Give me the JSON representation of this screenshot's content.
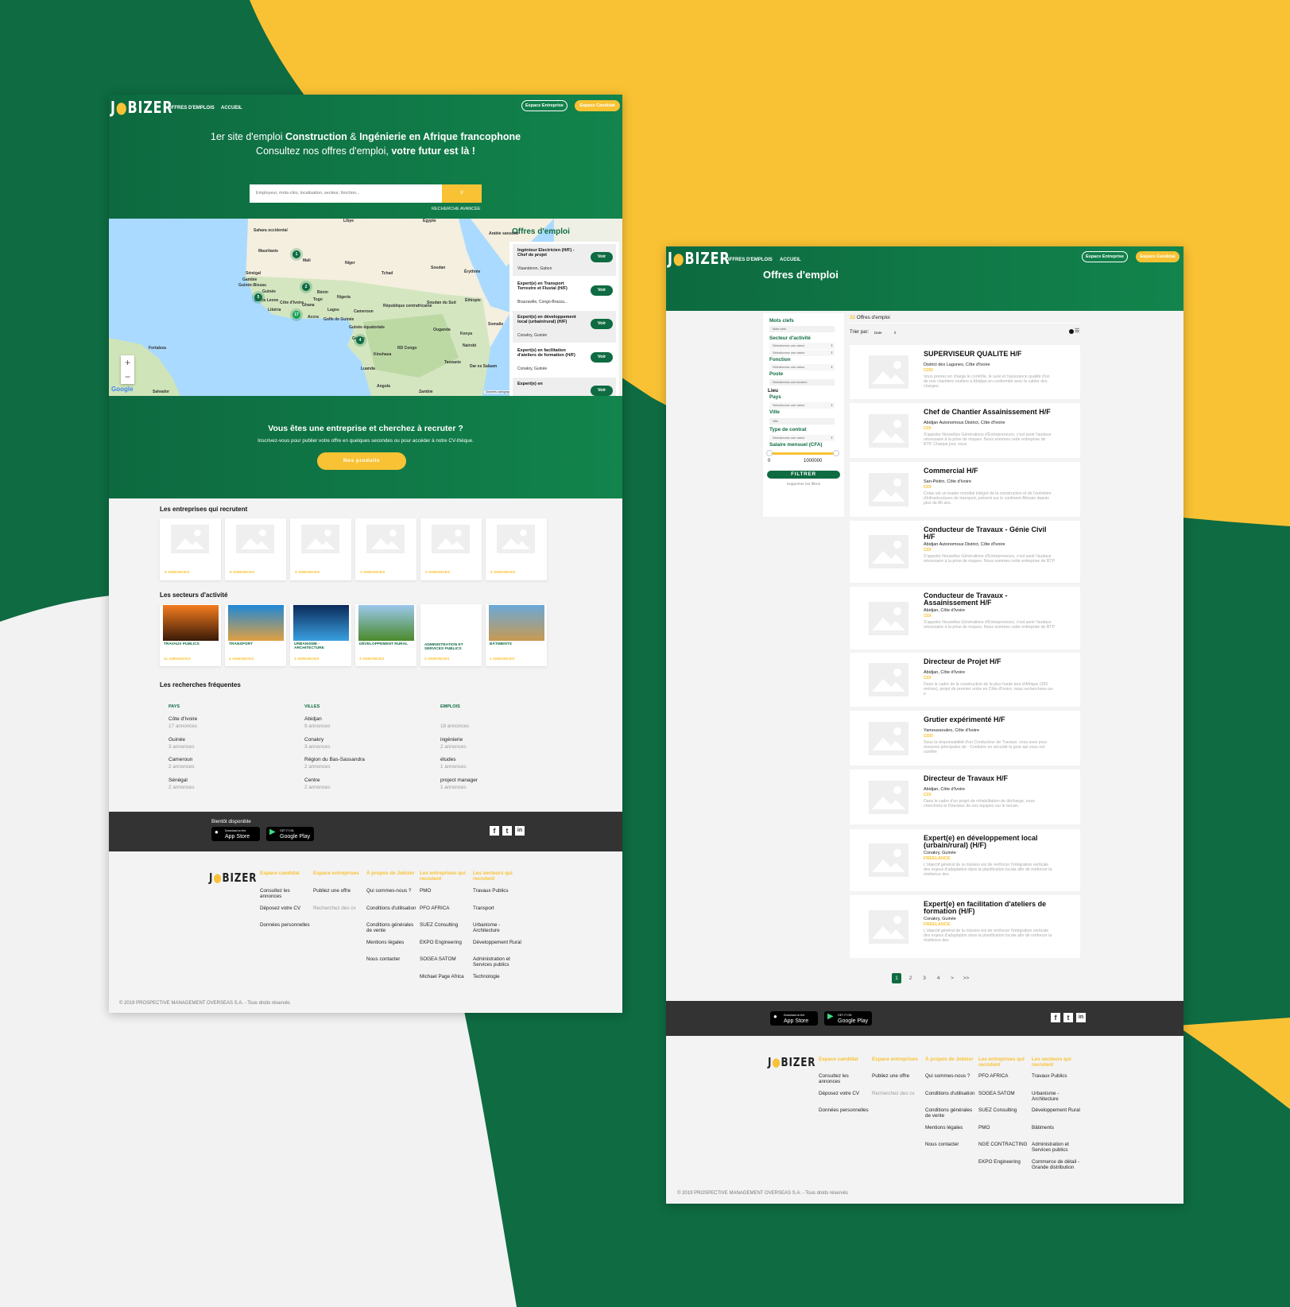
{
  "colors": {
    "green": "#0e6b42",
    "yellow": "#f9c234",
    "light": "#f3f3f3",
    "dark": "#333333"
  },
  "home": {
    "logo": "JOBIZER",
    "nav": [
      "OFFRES D'EMPLOIS",
      "ACCUEIL"
    ],
    "btn_company": "Espace Entreprise",
    "btn_candidate": "Espace Candidat",
    "headline_1a": "1er site d'emploi ",
    "headline_1b": "Construction",
    "headline_1c": " & ",
    "headline_1d": "Ingénierie en Afrique francophone",
    "headline_2a": "Consultez nos offres d'emploi, ",
    "headline_2b": "votre futur est là !",
    "search_placeholder": "Employeur, mots-clés, localisation, secteur, fonction...",
    "search_icon": "search-icon",
    "advanced": "RECHERCHE AVANCÉE",
    "map": {
      "labels": [
        "Libye",
        "Égypte",
        "Sahara occidental",
        "Mauritanie",
        "Mali",
        "Niger",
        "Tchad",
        "Soudan",
        "Érythrée",
        "Arabie saoudite",
        "Sénégal",
        "Gambie",
        "Guinée-Bissau",
        "Guinée",
        "Sierra Leone",
        "Libéria",
        "Côte d'Ivoire",
        "Ghana",
        "Togo",
        "Bénin",
        "Nigeria",
        "Cameroun",
        "République centrafricaine",
        "Soudan du Sud",
        "Éthiopie",
        "Somalie",
        "Ouganda",
        "Kenya",
        "RD Congo",
        "Tanzanie",
        "Angola",
        "Zambie",
        "Guinée équatoriale",
        "Gabon",
        "Golfe de Guinée",
        "Accra",
        "Lagos",
        "Kinshasa",
        "Luanda",
        "Nairobi",
        "Dar es Salaam",
        "Fortaleza",
        "Salvador"
      ],
      "clusters": [
        1,
        2,
        5,
        17,
        4
      ],
      "zoom_in": "+",
      "zoom_out": "−",
      "google": "Google",
      "attribution": "Données cartographiques ©2019 Google, INEGI, ORION-ME   Conditions d'utilisation",
      "panel_title": "Offres d'emploi",
      "voir": "Voir",
      "jobs": [
        {
          "title": "Ingénieur Electricien (H/F) - Chef de projet",
          "loc": "Vlaanderen, Gabon"
        },
        {
          "title": "Expert(e) en Transport Terrestre et Fluvial (H/F)",
          "loc": "Brazzaville, Congo-Brazza..."
        },
        {
          "title": "Expert(e) en développement local (urbain/rural) (H/F)",
          "loc": "Conakry, Guinée"
        },
        {
          "title": "Expert(e) en facilitation d'ateliers de formation (H/F)",
          "loc": "Conakry, Guinée"
        },
        {
          "title": "Expert(e) en",
          "loc": ""
        }
      ]
    },
    "recruit_title": "Vous êtes une entreprise et cherchez à recruter ?",
    "recruit_sub": "Inscrivez-vous pour publier votre offre en quelques secondes ou pour accéder à notre CV-thèque.",
    "recruit_btn": "Nos produits",
    "companies_title": "Les entreprises qui recrutent",
    "companies": [
      "6 ANNONCES",
      "6 ANNONCES",
      "4 ANNONCES",
      "3 ANNONCES",
      "2 ANNONCES",
      "2 ANNONCES"
    ],
    "sectors_title": "Les secteurs d'activité",
    "sectors": [
      {
        "name": "TRAVAUX PUBLICS",
        "count": "11 ANNONCES"
      },
      {
        "name": "TRANSPORT",
        "count": "4 ANNONCES"
      },
      {
        "name": "URBANISME - ARCHITECTURE",
        "count": "3 ANNONCES"
      },
      {
        "name": "DÉVELOPPEMENT RURAL",
        "count": "3 ANNONCES"
      },
      {
        "name": "ADMINISTRATION ET SERVICES PUBLICS",
        "count": "2 ANNONCES"
      },
      {
        "name": "BÂTIMENTS",
        "count": "1 ANNONCES"
      }
    ],
    "frequent_title": "Les recherches fréquentes",
    "frequent": [
      {
        "header": "PAYS",
        "items": [
          {
            "n": "Côte d'Ivoire",
            "c": "17 annonces"
          },
          {
            "n": "Guinée",
            "c": "3 annonces"
          },
          {
            "n": "Cameroun",
            "c": "2 annonces"
          },
          {
            "n": "Sénégal",
            "c": "2 annonces"
          }
        ]
      },
      {
        "header": "VILLES",
        "items": [
          {
            "n": "Abidjan",
            "c": "9 annonces"
          },
          {
            "n": "Conakry",
            "c": "3 annonces"
          },
          {
            "n": "Région du Bas-Sassandra",
            "c": "2 annonces"
          },
          {
            "n": "Centre",
            "c": "2 annonces"
          }
        ]
      },
      {
        "header": "EMPLOIS",
        "items": [
          {
            "n": "",
            "c": "18 annonces"
          },
          {
            "n": "ingénierie",
            "c": "2 annonces"
          },
          {
            "n": "études",
            "c": "1 annonces"
          },
          {
            "n": "project manager",
            "c": "1 annonces"
          }
        ]
      }
    ],
    "soon": "Bientôt disponible",
    "footer_cols": [
      {
        "h": "Espace candidat",
        "items": [
          "Consultez les annonces",
          "Déposez votre CV",
          "Données personnelles"
        ]
      },
      {
        "h": "Espace entreprises",
        "items": [
          "Publiez une offre",
          "Recherchez des cv"
        ]
      },
      {
        "h": "À propos de Jobizer",
        "items": [
          "Qui sommes-nous ?",
          "Conditions d'utilisation",
          "Conditions générales de vente",
          "Mentions légales",
          "Nous contacter"
        ]
      },
      {
        "h": "Les entreprises qui recrutent",
        "items": [
          "PMO",
          "PFO AFRICA",
          "SUEZ Consulting",
          "EKPO Engineering",
          "SOGEA SATOM",
          "Michael Page Africa"
        ]
      },
      {
        "h": "Les secteurs qui recrutent",
        "items": [
          "Travaux Publics",
          "Transport",
          "Urbanisme - Architecture",
          "Développement Rural",
          "Administration et Services publics",
          "Technologie"
        ]
      }
    ],
    "copyright": "© 2019 PROSPECTIVE MANAGEMENT OVERSEAS S.A. - Tous droits réservés"
  },
  "stores": {
    "app_small": "Download on the",
    "app": "App Store",
    "play_small": "GET IT ON",
    "play": "Google Play"
  },
  "social": [
    "f",
    "t",
    "in"
  ],
  "listing": {
    "logo": "JOBIZER",
    "nav": [
      "OFFRES D'EMPLOIS",
      "ACCUEIL"
    ],
    "btn_company": "Espace Entreprise",
    "btn_candidate": "Espace Candidat",
    "title": "Offres d'emploi",
    "filters": {
      "mots_clefs": "Mots clefs",
      "mots_ph": "Mots clefs",
      "secteur": "Secteur d'activité",
      "select_value": "Sélectionnez une valeur",
      "fonction": "Fonction",
      "poste": "Poste",
      "poste_ph": "Sélectionnez une fonction",
      "lieu": "Lieu",
      "pays": "Pays",
      "ville": "Ville",
      "ville_ph": "Ville",
      "contrat": "Type de contrat",
      "salaire": "Salaire mensuel (CFA)",
      "salary_min": "0",
      "salary_max": "1000000",
      "salary_range_selected": [
        0,
        1000000
      ],
      "filter_btn": "FILTRER",
      "clear": "Supprimer les filtres"
    },
    "count": "32",
    "count_label": " Offres d'emploi",
    "sort_label": "Trier par:",
    "sort_value": "Date",
    "view_icons": [
      "map-view-icon",
      "list-view-icon"
    ],
    "jobs": [
      {
        "title": "SUPERVISEUR QUALITE H/F",
        "loc": "District des Lagunes, Côte d'Ivoire",
        "type": "CDD",
        "desc": "Vous prenez en charge le contrôle, le suivi et l'assurance qualité d'un de nos chantiers routiers à Abidjan en conformité avec le cahier des charges."
      },
      {
        "title": "Chef de Chantier Assainissement H/F",
        "loc": "Abidjan Autonomous District, Côte d'Ivoire",
        "type": "CDI",
        "desc": "S'appeler Nouvelles Générations d'Entrepreneurs, c'est avoir l'audace nécessaire à la prise de risques. Nous sommes cette entreprise de BTP. Chaque jour, nous"
      },
      {
        "title": "Commercial H/F",
        "loc": "San-Pédro, Côte d'Ivoire",
        "type": "CDI",
        "desc": "Colas est un leader mondial intégré de la construction et de l'entretien d'infrastructures de transport, présent sur le continent Africain depuis plus de 80 ans."
      },
      {
        "title": "Conducteur de Travaux - Génie Civil H/F",
        "loc": "Abidjan Autonomous District, Côte d'Ivoire",
        "type": "CDI",
        "desc": "S'appeler Nouvelles Générations d'Entrepreneurs, c'est avoir l'audace nécessaire à la prise de risques. Nous sommes cette entreprise de BTP"
      },
      {
        "title": "Conducteur de Travaux - Assainissement H/F",
        "loc": "Abidjan, Côte d'Ivoire",
        "type": "CDI",
        "desc": "S'appeler Nouvelles Générations d'Entrepreneurs, c'est avoir l'audace nécessaire à la prise de risques. Nous sommes cette entreprise de BTP"
      },
      {
        "title": "Directeur de Projet H/F",
        "loc": "Abidjan, Côte d'Ivoire",
        "type": "CDI",
        "desc": "Dans le cadre de la construction de la plus haute tour d'Afrique (283 mètres), projet de premier ordre en Côte d'Ivoire, nous recherchons un-e"
      },
      {
        "title": "Grutier expérimenté H/F",
        "loc": "Yamoussoukro, Côte d'Ivoire",
        "type": "CDD",
        "desc": "Sous la responsabilité d'un Conducteur de Travaux, vous avez pour missions principales de : Conduire en sécurité la grue qui vous est confiée"
      },
      {
        "title": "Directeur de Travaux H/F",
        "loc": "Abidjan, Côte d'Ivoire",
        "type": "CDI",
        "desc": "Dans le cadre d'un projet de réhabilitation de décharge, nous cherchons le Directeur de nos équipes sur le terrain."
      },
      {
        "title": "Expert(e) en développement local (urbain/rural) (H/F)",
        "loc": "Conakry, Guinée",
        "type": "FREELANCE",
        "desc": "L'objectif général de la mission est de renforcer l'intégration verticale des enjeux d'adaptation dans la planification locale afin de renforcer la résilience des"
      },
      {
        "title": "Expert(e) en facilitation d'ateliers de formation (H/F)",
        "loc": "Conakry, Guinée",
        "type": "FREELANCE",
        "desc": "L'objectif général de la mission est de renforcer l'intégration verticale des enjeux d'adaptation dans la planification locale afin de renforcer la résilience des"
      }
    ],
    "pagination": [
      "1",
      "2",
      "3",
      "4",
      ">",
      ">>"
    ],
    "current_page": "1",
    "footer_cols": [
      {
        "h": "Espace candidat",
        "items": [
          "Consultez les annonces",
          "Déposez votre CV",
          "Données personnelles"
        ]
      },
      {
        "h": "Espace entreprises",
        "items": [
          "Publiez une offre",
          "Recherchez des cv"
        ]
      },
      {
        "h": "À propos de Jobizer",
        "items": [
          "Qui sommes-nous ?",
          "Conditions d'utilisation",
          "Conditions générales de vente",
          "Mentions légales",
          "Nous contacter"
        ]
      },
      {
        "h": "Les entreprises qui recrutent",
        "items": [
          "PFO AFRICA",
          "SOGEA SATOM",
          "SUEZ Consulting",
          "PMO",
          "NGE CONTRACTING",
          "EKPO Engineering"
        ]
      },
      {
        "h": "Les secteurs qui recrutent",
        "items": [
          "Travaux Publics",
          "Urbanisme - Architecture",
          "Développement Rural",
          "Bâtiments",
          "Administration et Services publics",
          "Commerce de détail - Grande distribution"
        ]
      }
    ],
    "copyright": "© 2019 PROSPECTIVE MANAGEMENT OVERSEAS S.A. - Tous droits réservés"
  }
}
